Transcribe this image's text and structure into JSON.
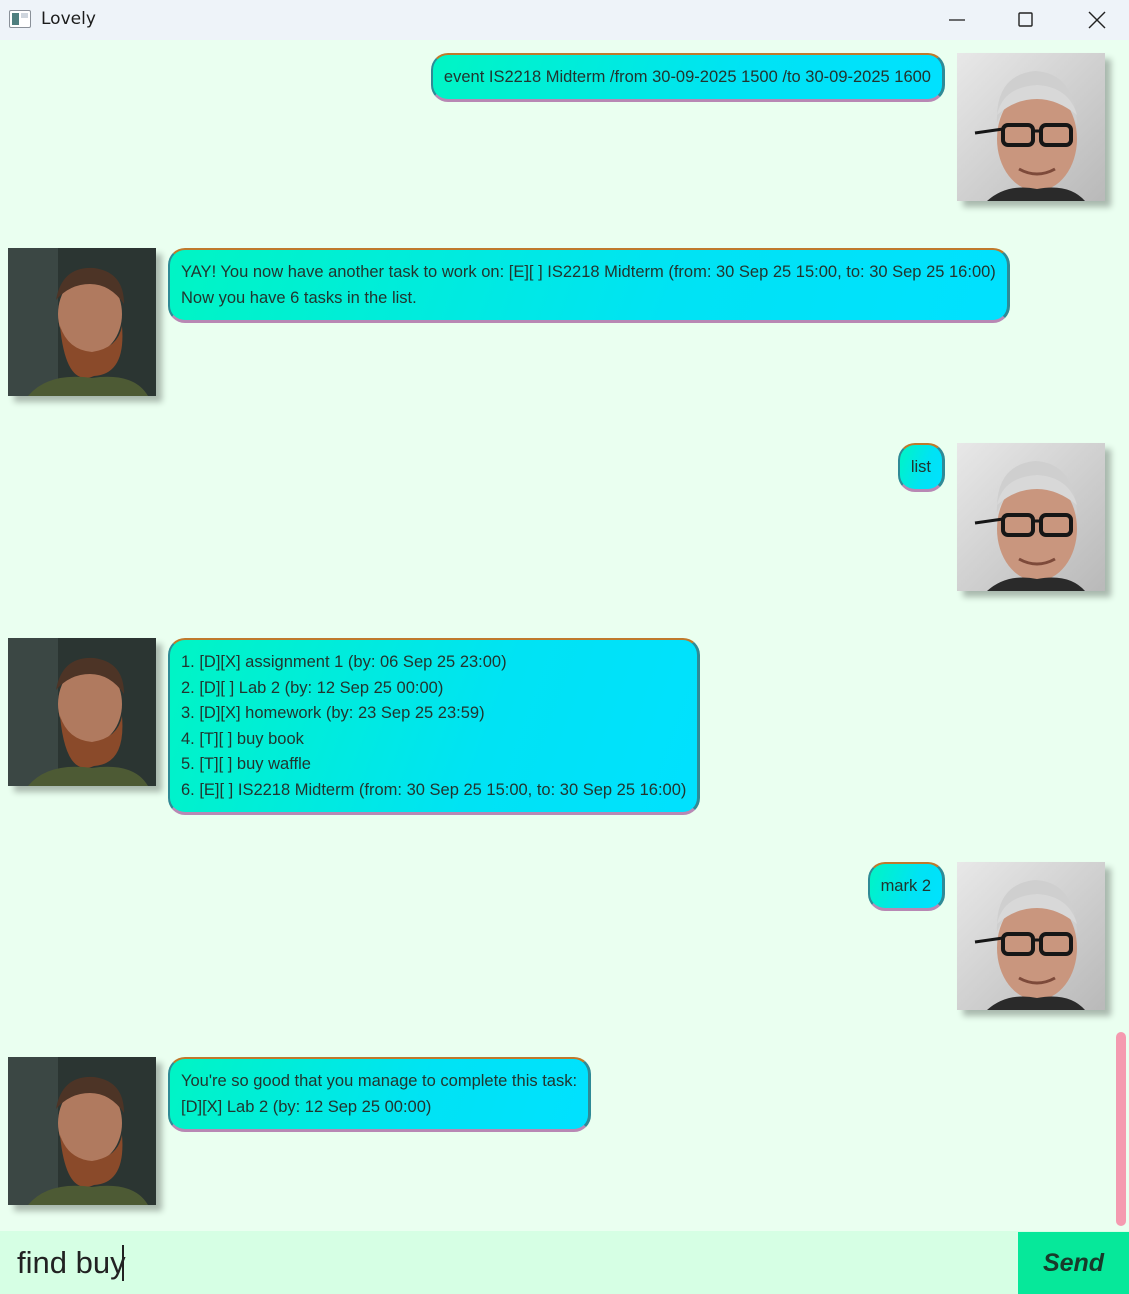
{
  "window": {
    "title": "Lovely"
  },
  "messages": [
    {
      "sender": "user",
      "lines": [
        "event IS2218 Midterm /from 30-09-2025 1500 /to 30-09-2025 1600"
      ]
    },
    {
      "sender": "bot",
      "lines": [
        "YAY! You now have another task to work on: [E][ ] IS2218 Midterm (from: 30 Sep 25 15:00, to: 30 Sep 25 16:00)",
        "Now you have 6 tasks in the list."
      ]
    },
    {
      "sender": "user",
      "lines": [
        "list"
      ]
    },
    {
      "sender": "bot",
      "lines": [
        "1. [D][X] assignment 1 (by: 06 Sep 25 23:00)",
        "2. [D][ ] Lab 2 (by: 12 Sep 25 00:00)",
        "3. [D][X] homework (by: 23 Sep 25 23:59)",
        "4. [T][ ] buy book",
        "5. [T][ ] buy waffle",
        "6. [E][ ] IS2218 Midterm (from: 30 Sep 25 15:00, to: 30 Sep 25 16:00)"
      ]
    },
    {
      "sender": "user",
      "lines": [
        "mark 2"
      ]
    },
    {
      "sender": "bot",
      "lines": [
        "You're so good that you manage to complete this task:",
        "[D][X] Lab 2 (by: 12 Sep 25 00:00)"
      ]
    }
  ],
  "input": {
    "value": "find buy"
  },
  "send_button": {
    "label": "Send"
  },
  "colors": {
    "background": "#eafff0",
    "send": "#06e89a",
    "scrollbar": "#f59ab0"
  }
}
